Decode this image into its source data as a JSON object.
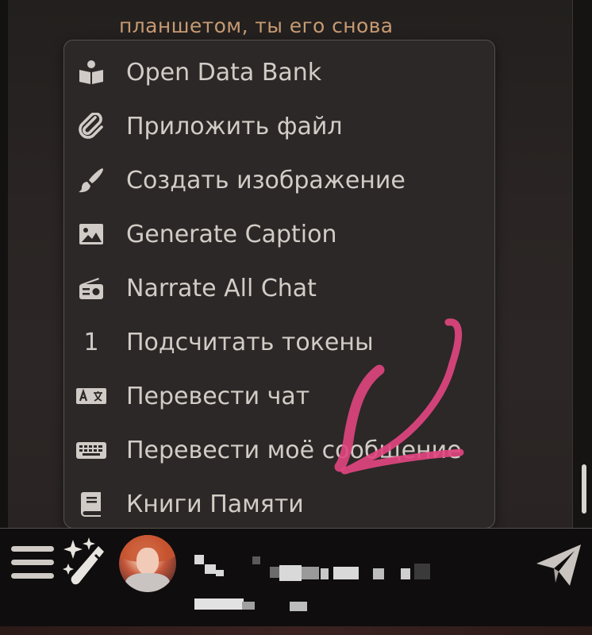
{
  "chat": {
    "visible_text": "планшетом, ты его снова"
  },
  "menu": {
    "items": [
      {
        "label": "Open Data Bank",
        "icon": "data-bank-icon"
      },
      {
        "label": "Приложить файл",
        "icon": "paperclip-icon"
      },
      {
        "label": "Создать изображение",
        "icon": "paintbrush-icon"
      },
      {
        "label": "Generate Caption",
        "icon": "image-icon"
      },
      {
        "label": "Narrate All Chat",
        "icon": "radio-icon"
      },
      {
        "label": "Подсчитать токены",
        "icon": "number-one-icon",
        "glyph": "1"
      },
      {
        "label": "Перевести чат",
        "icon": "translate-icon"
      },
      {
        "label": "Перевести моё сообщение",
        "icon": "keyboard-icon"
      },
      {
        "label": "Книги Памяти",
        "icon": "book-icon"
      }
    ]
  },
  "bottom_bar": {
    "menu_icon": "hamburger-icon",
    "wand_icon": "magic-wand-icon",
    "send_icon": "send-icon"
  },
  "colors": {
    "chat_text": "#c79a72",
    "menu_bg": "#2b2827",
    "menu_text": "#d2ccc6",
    "annotation": "#e0457f"
  }
}
